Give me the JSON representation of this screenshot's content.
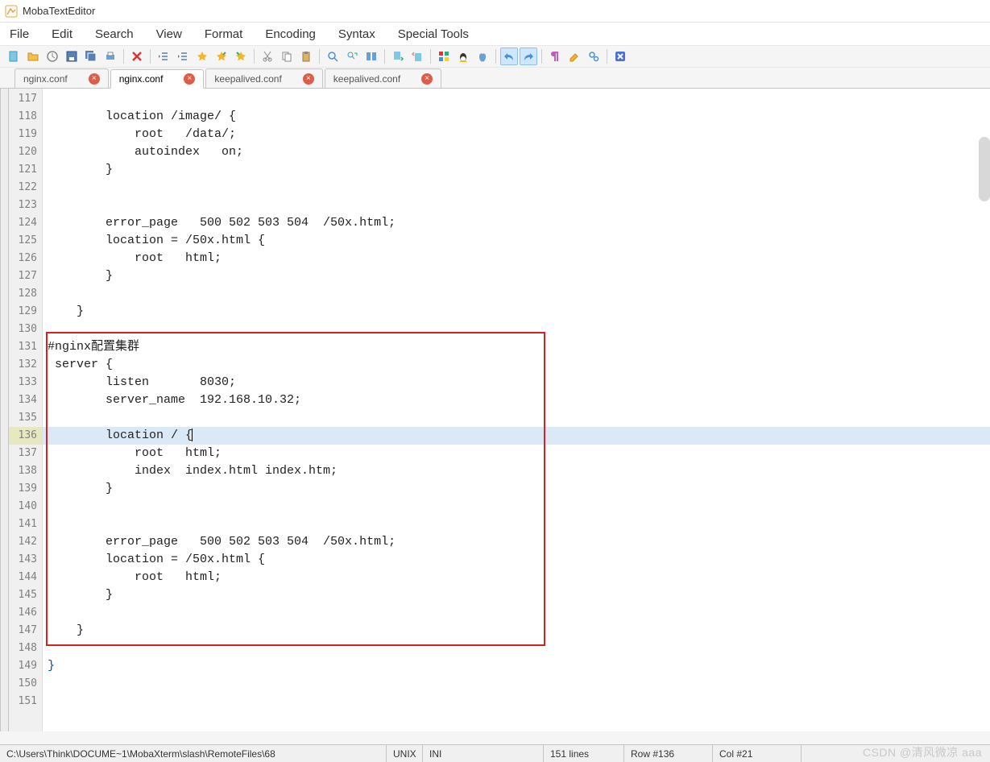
{
  "app": {
    "title": "MobaTextEditor"
  },
  "menu": {
    "items": [
      "File",
      "Edit",
      "Search",
      "View",
      "Format",
      "Encoding",
      "Syntax",
      "Special Tools"
    ]
  },
  "toolbar_icons": [
    "new-file-icon",
    "open-folder-icon",
    "recent-icon",
    "save-icon",
    "save-all-icon",
    "print-icon",
    "sep",
    "close-icon",
    "sep",
    "outdent-icon",
    "indent-icon",
    "bookmark-add-icon",
    "bookmark-prev-icon",
    "bookmark-next-icon",
    "sep",
    "cut-icon",
    "copy-icon",
    "paste-icon",
    "sep",
    "find-icon",
    "replace-icon",
    "columns-icon",
    "sep",
    "sync-down-icon",
    "sync-up-icon",
    "sep",
    "windows-icon",
    "linux-icon",
    "apple-icon",
    "sep",
    "undo-icon",
    "redo-icon",
    "sep",
    "pilcrow-icon",
    "highlight-icon",
    "settings-gears-icon",
    "sep",
    "exit-icon"
  ],
  "tabs": [
    {
      "label": "nginx.conf",
      "active": false
    },
    {
      "label": "nginx.conf",
      "active": true
    },
    {
      "label": "keepalived.conf",
      "active": false
    },
    {
      "label": "keepalived.conf",
      "active": false
    }
  ],
  "editor": {
    "first_line_no": 117,
    "current_line_no": 136,
    "lines": [
      "",
      "        location /image/ {",
      "            root   /data/;",
      "            autoindex   on;",
      "        }",
      "",
      "",
      "        error_page   500 502 503 504  /50x.html;",
      "        location = /50x.html {",
      "            root   html;",
      "        }",
      "",
      "    }",
      "",
      "#nginx配置集群",
      " server {",
      "        listen       8030;",
      "        server_name  192.168.10.32;",
      "",
      "        location / {",
      "            root   html;",
      "            index  index.html index.htm;",
      "        }",
      "",
      "",
      "        error_page   500 502 503 504  /50x.html;",
      "        location = /50x.html {",
      "            root   html;",
      "        }",
      "",
      "    }",
      "",
      "}",
      "",
      ""
    ],
    "annotation_box": {
      "top_line": 131,
      "bottom_line": 147
    }
  },
  "status": {
    "path": "C:\\Users\\Think\\DOCUME~1\\MobaXterm\\slash\\RemoteFiles\\68",
    "encoding": "UNIX",
    "lang": "INI",
    "lines": "151 lines",
    "row": "Row #136",
    "col": "Col #21"
  },
  "watermark": "CSDN @清风微凉 aaa"
}
